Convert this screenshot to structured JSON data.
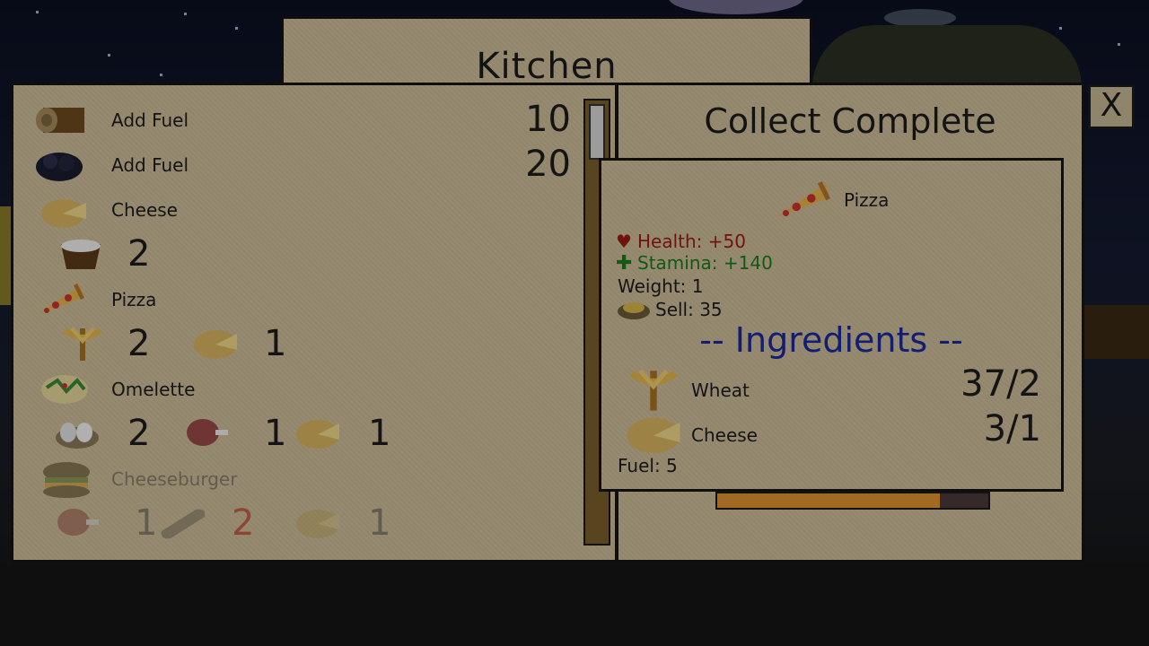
{
  "window": {
    "title": "Kitchen",
    "close_label": "X"
  },
  "right_header": "Collect Complete",
  "recipes": [
    {
      "label": "Add Fuel",
      "value": "10",
      "icon": "log-icon"
    },
    {
      "label": "Add Fuel",
      "value": "20",
      "icon": "coal-icon"
    },
    {
      "label": "Cheese",
      "icon": "cheese-icon",
      "ingredients": [
        {
          "icon": "milk-bucket-icon",
          "qty": "2"
        }
      ]
    },
    {
      "label": "Pizza",
      "icon": "pizza-icon",
      "selected": true,
      "ingredients": [
        {
          "icon": "wheat-icon",
          "qty": "2"
        },
        {
          "icon": "cheese-icon",
          "qty": "1"
        }
      ]
    },
    {
      "label": "Omelette",
      "icon": "omelette-icon",
      "ingredients": [
        {
          "icon": "eggs-icon",
          "qty": "2"
        },
        {
          "icon": "meat-icon",
          "qty": "1"
        },
        {
          "icon": "cheese-icon",
          "qty": "1"
        }
      ]
    },
    {
      "label": "Cheeseburger",
      "icon": "cheeseburger-icon",
      "faded": true,
      "ingredients": [
        {
          "icon": "meat-icon",
          "qty": "1"
        },
        {
          "icon": "bread-icon",
          "qty": "2",
          "missing": true
        },
        {
          "icon": "cheese-icon",
          "qty": "1"
        }
      ]
    }
  ],
  "detail": {
    "name": "Pizza",
    "health": "Health: +50",
    "stamina": "Stamina: +140",
    "weight": "Weight: 1",
    "sell": "Sell: 35",
    "ingredients_title": "-- Ingredients --",
    "ingredients": [
      {
        "name": "Wheat",
        "count": "37/2"
      },
      {
        "name": "Cheese",
        "count": "3/1"
      }
    ],
    "fuel": "Fuel: 5"
  },
  "progress": 0.82,
  "colors": {
    "health": "#9b1a14",
    "stamina": "#1d7a1d",
    "ingredients_title": "#1b2aa0",
    "missing": "#c03b2b"
  }
}
